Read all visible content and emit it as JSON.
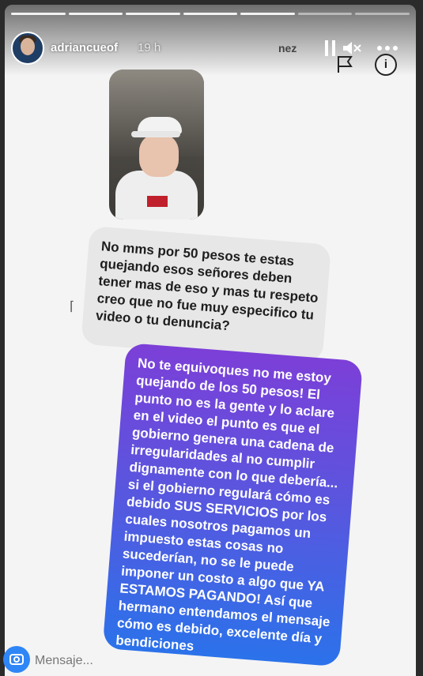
{
  "story": {
    "username": "adriancueof",
    "time_ago": "19 h",
    "overlay_text": "nez",
    "progress_segments": 7,
    "progress_active": 5
  },
  "controls": {
    "pause_icon": "pause-icon",
    "mute_icon": "mute-icon",
    "more_icon": "more-icon",
    "info_label": "i"
  },
  "messages": {
    "received": "No mms por 50 pesos te estas quejando esos señores deben tener mas de eso y mas tu respeto creo que no fue muy especifico tu video o tu denuncia?",
    "sent": "No te equivoques no me estoy quejando de los 50 pesos! El punto no es la gente y lo aclare en el video el punto es que el gobierno genera una cadena de irregularidades al no cumplir dignamente con lo que debería... si el gobierno regulará cómo es debido SUS SERVICIOS por los cuales nosotros pagamos un impuesto estas cosas no sucederían, no se le puede imponer un costo a algo que YA ESTAMOS PAGANDO! Así que hermano entendamos el mensaje cómo es debido, excelente día y bendiciones"
  },
  "footer": {
    "message_placeholder": "Mensaje..."
  },
  "colors": {
    "sent_gradient_top": "#7c3fd8",
    "sent_gradient_bottom": "#2b72ea",
    "received_bubble": "#e7e7e7",
    "camera_button": "#2f86f6"
  }
}
